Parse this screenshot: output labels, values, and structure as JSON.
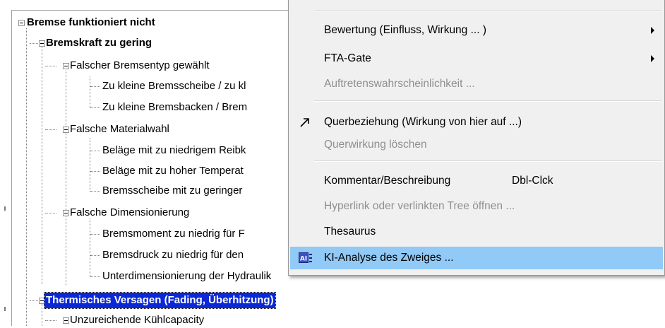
{
  "tree": {
    "nodes": [
      {
        "label": "Bremse funktioniert nicht"
      },
      {
        "label": "Bremskraft zu gering"
      },
      {
        "label": "Falscher Bremsentyp gewählt"
      },
      {
        "label": "Zu kleine Bremsscheibe / zu kl"
      },
      {
        "label": "Zu kleine Bremsbacken / Brem"
      },
      {
        "label": "Falsche Materialwahl"
      },
      {
        "label": "Beläge mit zu niedrigem Reibk"
      },
      {
        "label": "Beläge mit zu hoher Temperat"
      },
      {
        "label": "Bremsscheibe mit zu geringer"
      },
      {
        "label": "Falsche Dimensionierung"
      },
      {
        "label": "Bremsmoment zu niedrig für F"
      },
      {
        "label": "Bremsdruck zu niedrig für den"
      },
      {
        "label": "Unterdimensionierung der Hydraulik"
      },
      {
        "label": "Thermisches Versagen (Fading, Überhitzung)"
      },
      {
        "label": "Unzureichende Kühlcapacity"
      }
    ]
  },
  "context_menu": {
    "items": [
      {
        "label": "Bewertung (Einfluss, Wirkung ... )"
      },
      {
        "label": "FTA-Gate"
      },
      {
        "label": "Auftretenswahrscheinlichkeit ..."
      },
      {
        "label": "Querbeziehung (Wirkung von hier auf ...)"
      },
      {
        "label": "Querwirkung löschen"
      },
      {
        "label": "Kommentar/Beschreibung",
        "shortcut": "Dbl-Clck"
      },
      {
        "label": "Hyperlink  oder verlinkten Tree öffnen ..."
      },
      {
        "label": "Thesaurus"
      },
      {
        "label": "KI-Analyse des Zweiges ..."
      }
    ],
    "ai_icon_text": "AI",
    "hover_color": "#91c9f7",
    "selection_color": "#0a28d7"
  }
}
